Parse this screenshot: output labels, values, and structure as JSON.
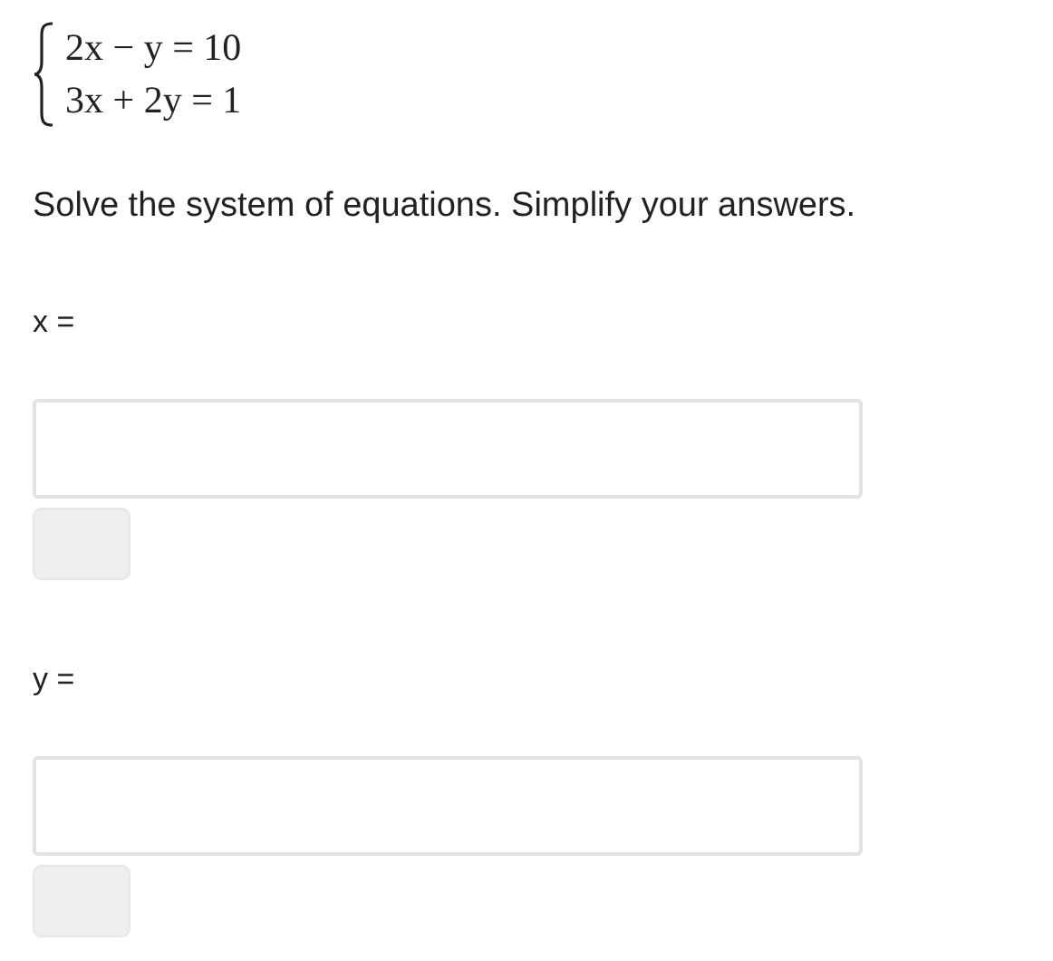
{
  "system": {
    "equations": [
      "2x − y = 10",
      "3x + 2y = 1"
    ]
  },
  "instruction": "Solve the system of equations. Simplify your answers.",
  "answers": [
    {
      "label": "x ="
    },
    {
      "label": "y ="
    }
  ]
}
